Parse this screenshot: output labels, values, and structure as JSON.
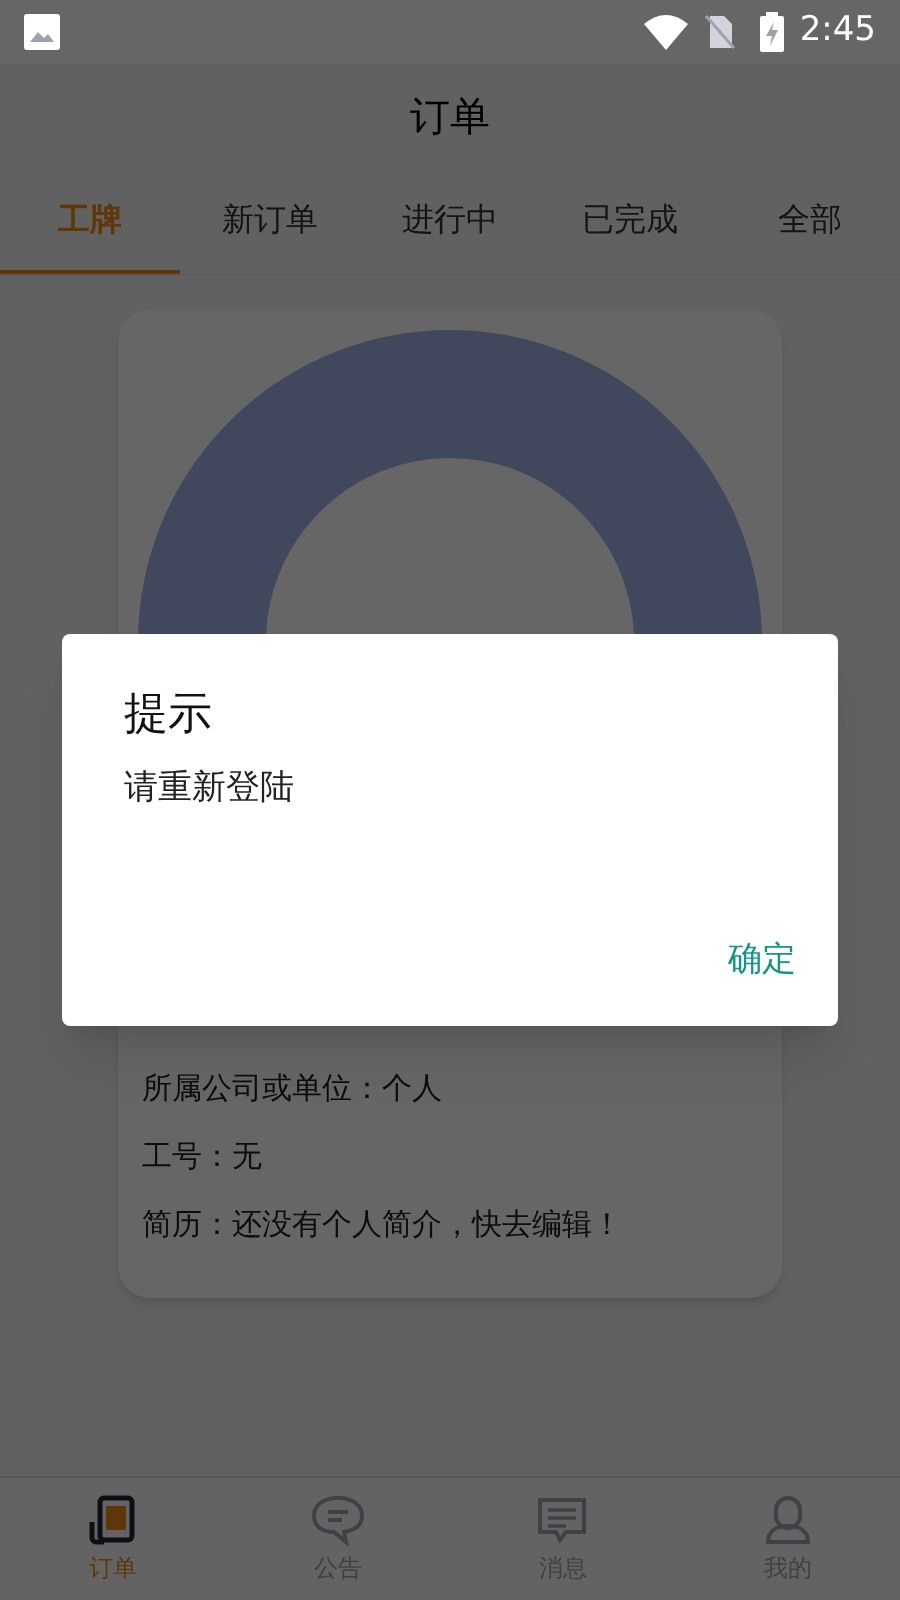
{
  "status_bar": {
    "time": "2:45"
  },
  "header": {
    "title": "订单"
  },
  "tabs": [
    {
      "label": "工牌",
      "selected": true
    },
    {
      "label": "新订单",
      "selected": false
    },
    {
      "label": "进行中",
      "selected": false
    },
    {
      "label": "已完成",
      "selected": false
    },
    {
      "label": "全部",
      "selected": false
    }
  ],
  "card": {
    "lines": [
      "所属公司或单位：个人",
      "工号：无",
      "简历：还没有个人简介，快去编辑！"
    ]
  },
  "dialog": {
    "title": "提示",
    "message": "请重新登陆",
    "button": "确定"
  },
  "bottom_nav": [
    {
      "label": "订单",
      "kind": "orders",
      "selected": true
    },
    {
      "label": "公告",
      "kind": "notice",
      "selected": false
    },
    {
      "label": "消息",
      "kind": "message",
      "selected": false
    },
    {
      "label": "我的",
      "kind": "profile",
      "selected": false
    }
  ]
}
